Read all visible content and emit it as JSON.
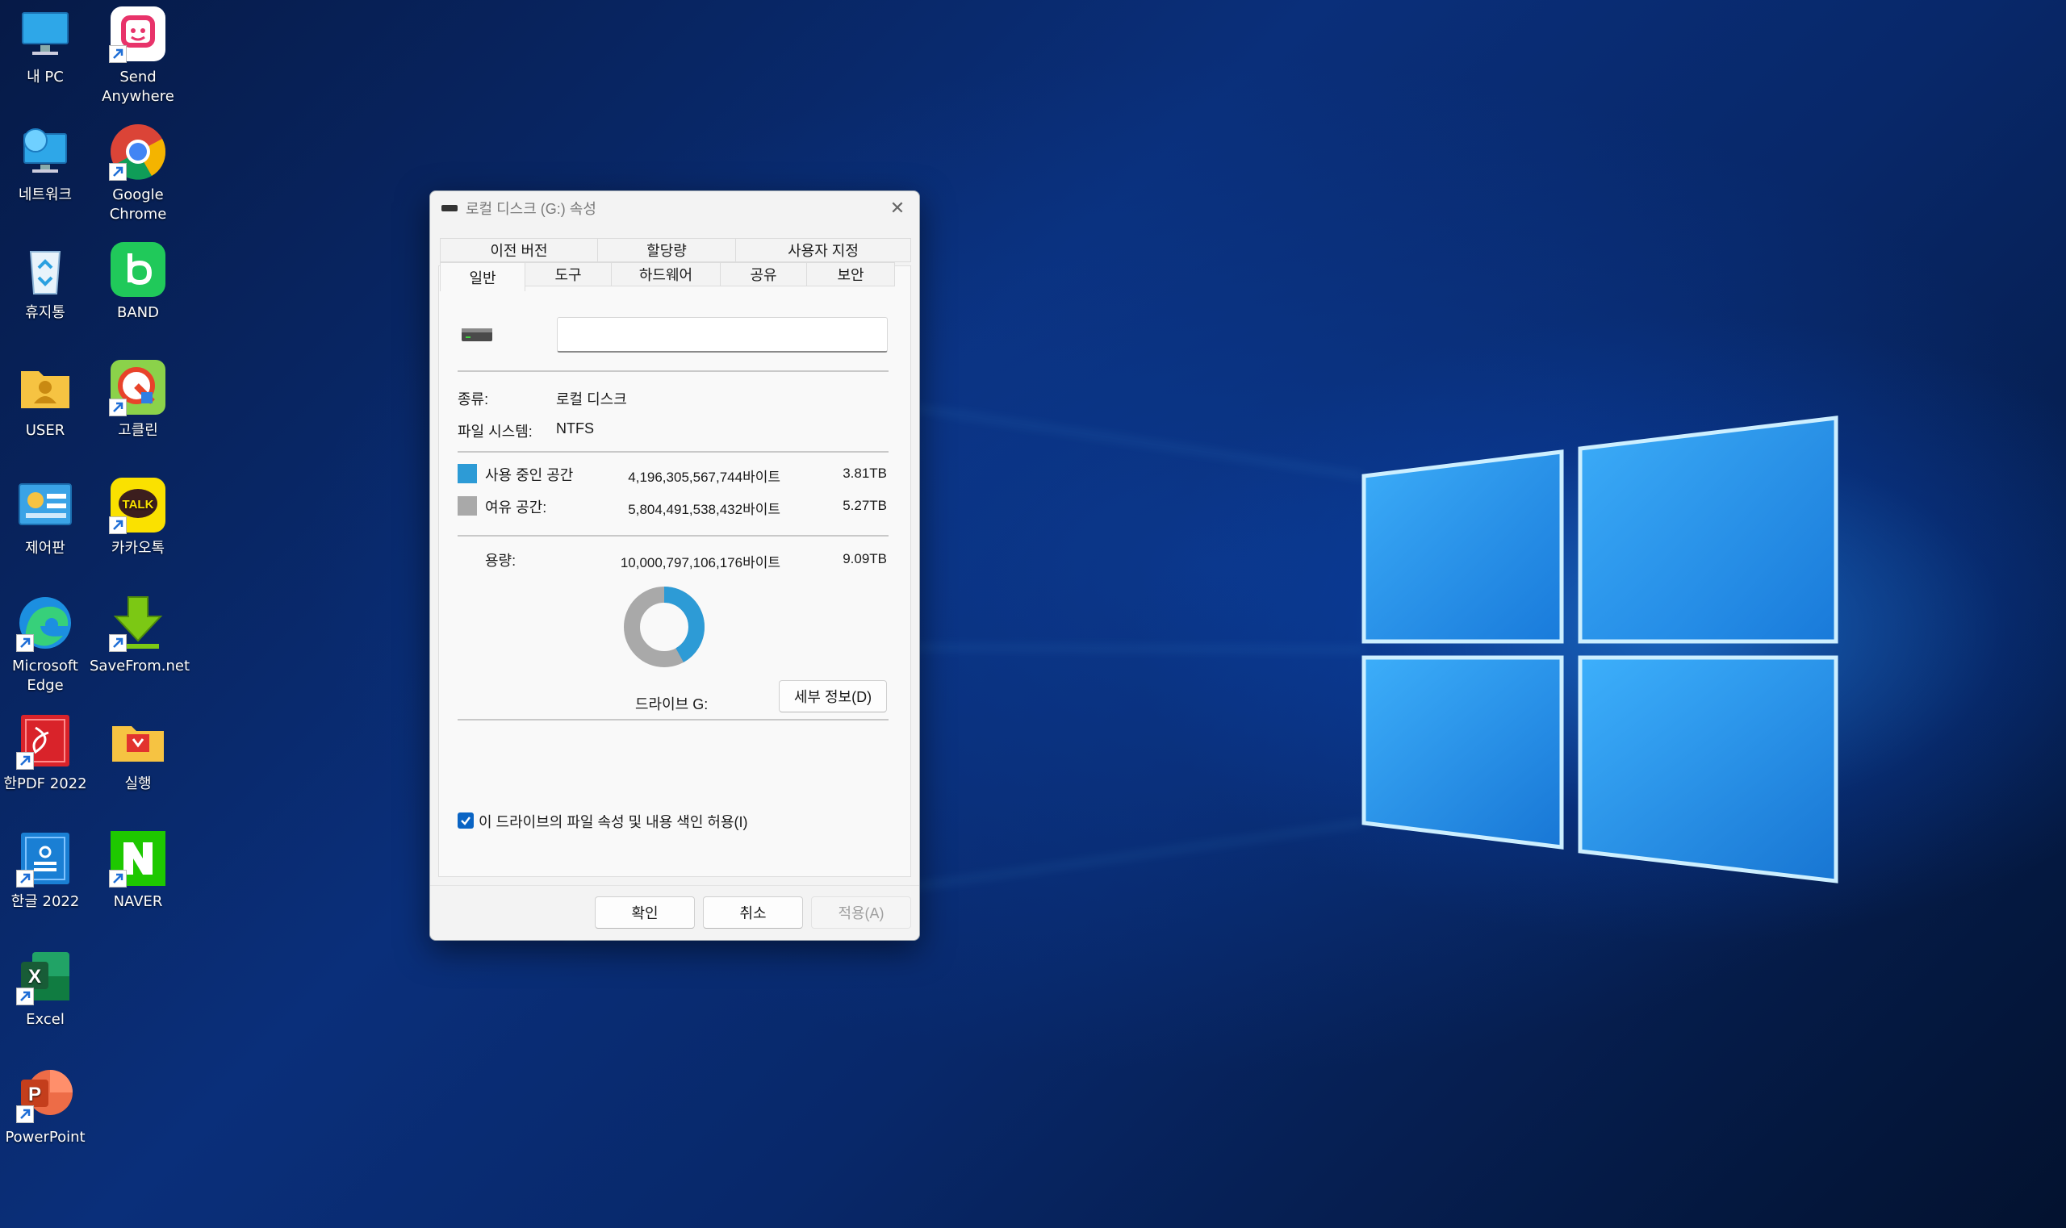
{
  "desktop": {
    "icons": [
      {
        "name": "my-pc",
        "label": "내 PC"
      },
      {
        "name": "send-anywhere",
        "label": "Send\nAnywhere"
      },
      {
        "name": "network",
        "label": "네트워크"
      },
      {
        "name": "google-chrome",
        "label": "Google\nChrome"
      },
      {
        "name": "recycle-bin",
        "label": "휴지통"
      },
      {
        "name": "band",
        "label": "BAND"
      },
      {
        "name": "user-folder",
        "label": "USER"
      },
      {
        "name": "gocleaner",
        "label": "고클린"
      },
      {
        "name": "control-panel",
        "label": "제어판"
      },
      {
        "name": "kakaotalk",
        "label": "카카오톡"
      },
      {
        "name": "microsoft-edge",
        "label": "Microsoft\nEdge"
      },
      {
        "name": "savefrom",
        "label": "SaveFrom.net"
      },
      {
        "name": "hanpdf",
        "label": "한PDF 2022"
      },
      {
        "name": "run",
        "label": "실행"
      },
      {
        "name": "hangul",
        "label": "한글 2022"
      },
      {
        "name": "naver",
        "label": "NAVER"
      },
      {
        "name": "excel",
        "label": "Excel"
      },
      {
        "name": "powerpoint",
        "label": "PowerPoint"
      }
    ]
  },
  "dialog": {
    "title": "로컬 디스크 (G:) 속성",
    "tabs_row1": [
      "이전 버전",
      "할당량",
      "사용자 지정"
    ],
    "tabs_row2": [
      "일반",
      "도구",
      "하드웨어",
      "공유",
      "보안"
    ],
    "active_tab": "일반",
    "volume_name": "",
    "type_label": "종류:",
    "type_value": "로컬 디스크",
    "fs_label": "파일 시스템:",
    "fs_value": "NTFS",
    "used_label": "사용 중인 공간",
    "used_bytes": "4,196,305,567,744바이트",
    "used_size": "3.81TB",
    "free_label": "여유 공간:",
    "free_bytes": "5,804,491,538,432바이트",
    "free_size": "5.27TB",
    "capacity_label": "용량:",
    "capacity_bytes": "10,000,797,106,176바이트",
    "capacity_size": "9.09TB",
    "drive_label": "드라이브 G:",
    "details_button": "세부 정보(D)",
    "index_checkbox_label": "이 드라이브의 파일 속성 및 내용 색인 허용(I)",
    "index_checked": true,
    "ok_button": "확인",
    "cancel_button": "취소",
    "apply_button": "적용(A)",
    "used_fraction": 0.4196,
    "used_color": "#2d9bd6",
    "free_color": "#a9a9a9"
  }
}
